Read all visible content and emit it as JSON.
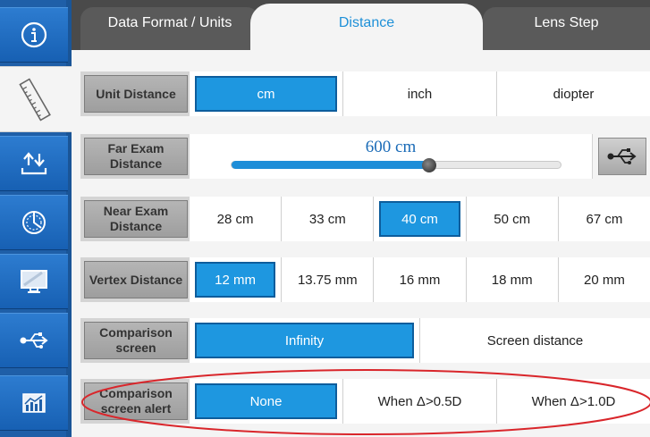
{
  "tabs": [
    {
      "label": "Data Format / Units"
    },
    {
      "label": "Distance"
    },
    {
      "label": "Lens Step"
    }
  ],
  "sidebar": {
    "items": [
      {
        "icon": "info-icon"
      },
      {
        "icon": "ruler-icon"
      },
      {
        "icon": "upload-download-icon"
      },
      {
        "icon": "compass-icon"
      },
      {
        "icon": "monitor-icon"
      },
      {
        "icon": "usb-icon"
      },
      {
        "icon": "chart-icon"
      }
    ],
    "active_index": 1
  },
  "rows": {
    "unit_distance": {
      "label": "Unit Distance",
      "options": [
        "cm",
        "inch",
        "diopter"
      ],
      "selected": "cm"
    },
    "far_exam": {
      "label": "Far Exam Distance",
      "value": "600 cm",
      "slider_fraction": 0.6
    },
    "near_exam": {
      "label": "Near Exam Distance",
      "options": [
        "28 cm",
        "33 cm",
        "40 cm",
        "50 cm",
        "67 cm"
      ],
      "selected": "40 cm"
    },
    "vertex": {
      "label": "Vertex Distance",
      "options": [
        "12 mm",
        "13.75 mm",
        "16 mm",
        "18 mm",
        "20 mm"
      ],
      "selected": "12 mm"
    },
    "comparison": {
      "label": "Comparison screen",
      "options": [
        "Infinity",
        "Screen distance"
      ],
      "selected": "Infinity"
    },
    "comparison_alert": {
      "label": "Comparison screen alert",
      "options": [
        "None",
        "When Δ>0.5D",
        "When Δ>1.0D"
      ],
      "selected": "None"
    }
  },
  "colors": {
    "accent": "#1e97e0",
    "sidebar": "#1f5fa8",
    "annotation": "#d9262b"
  }
}
